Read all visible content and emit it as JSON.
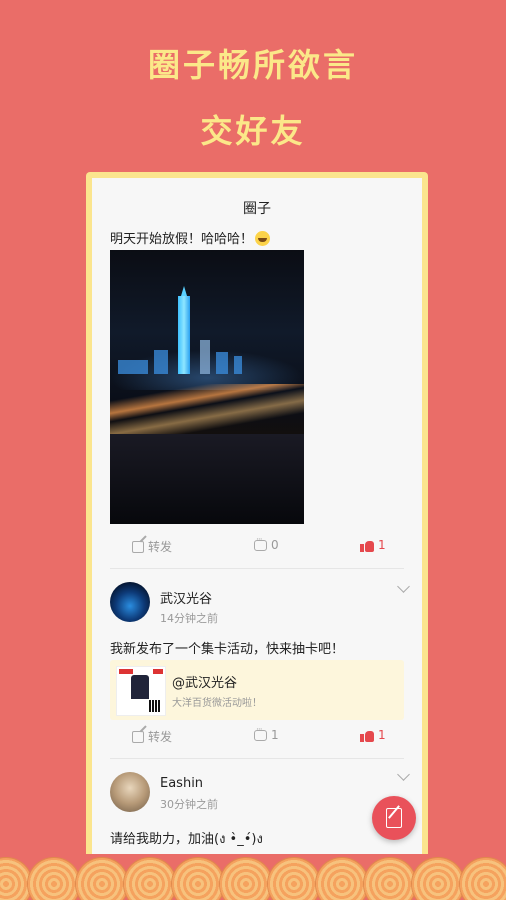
{
  "promo": {
    "headline_1": "圈子畅所欲言",
    "headline_2": "交好友"
  },
  "screen": {
    "title": "圈子"
  },
  "posts": [
    {
      "text": "明天开始放假！哈哈哈！",
      "emoji": "grinning-face",
      "image": "night-city-skyline-photo",
      "actions": {
        "share": "转发",
        "comments": "0",
        "likes": "1"
      }
    },
    {
      "user": "武汉光谷",
      "time": "14分钟之前",
      "text": "我新发布了一个集卡活动，快来抽卡吧！",
      "share_card": {
        "title": "@武汉光谷",
        "desc": "大洋百货微活动啦！"
      },
      "actions": {
        "share": "转发",
        "comments": "1",
        "likes": "1"
      }
    },
    {
      "user": "Eashin",
      "time": "30分钟之前",
      "text": "请给我助力，加油(ง •̀_•́)ง"
    }
  ],
  "colors": {
    "background": "#ea6d68",
    "headline": "#fbe889",
    "frame": "#fbe58e",
    "like": "#e5484d",
    "fab": "#e9515a"
  }
}
